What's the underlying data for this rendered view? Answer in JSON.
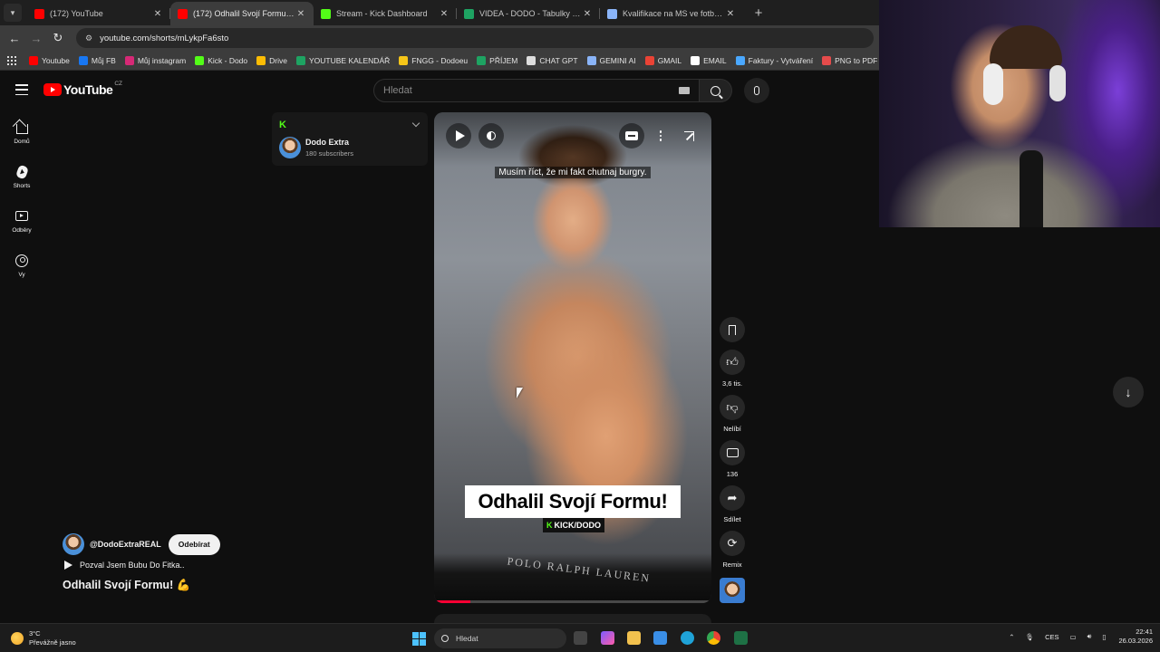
{
  "browser": {
    "tabs": [
      {
        "title": "(172) YouTube",
        "favicon_color": "#ff0000",
        "active": false
      },
      {
        "title": "(172) Odhalil Svojí Formu! 💪 🔊",
        "favicon_color": "#ff0000",
        "active": true
      },
      {
        "title": "Stream - Kick Dashboard",
        "favicon_color": "#53fc18",
        "active": false
      },
      {
        "title": "VIDEA - DODO - Tabulky Googl",
        "favicon_color": "#1ea362",
        "active": false
      },
      {
        "title": "Kvalifikace na MS ve fotbale 20...",
        "favicon_color": "#8ab4f8",
        "active": false
      }
    ],
    "url": "youtube.com/shorts/mLykpFa6sto",
    "bookmarks": [
      {
        "label": "Youtube",
        "color": "#ff0000"
      },
      {
        "label": "Můj FB",
        "color": "#1877f2"
      },
      {
        "label": "Můj instagram",
        "color": "#d62976"
      },
      {
        "label": "Kick - Dodo",
        "color": "#53fc18"
      },
      {
        "label": "Drive",
        "color": "#fbbc04"
      },
      {
        "label": "YOUTUBE KALENDÁŘ",
        "color": "#1ea362"
      },
      {
        "label": "FNGG - Dodoeu",
        "color": "#f5c518"
      },
      {
        "label": "PŘÍJEM",
        "color": "#1ea362"
      },
      {
        "label": "CHAT GPT",
        "color": "#dddddd"
      },
      {
        "label": "GEMINI AI",
        "color": "#8ab4f8"
      },
      {
        "label": "GMAIL",
        "color": "#ea4335"
      },
      {
        "label": "EMAIL",
        "color": "#ffffff"
      },
      {
        "label": "Faktury - Vytváření",
        "color": "#4aa8ff"
      },
      {
        "label": "PNG to PDF",
        "color": "#e54b4b"
      }
    ]
  },
  "youtube": {
    "logo_text": "YouTube",
    "country": "CZ",
    "search_placeholder": "Hledat",
    "nav": [
      {
        "label": "Domů"
      },
      {
        "label": "Shorts"
      },
      {
        "label": "Odběry"
      },
      {
        "label": "Vy"
      }
    ],
    "channel_card": {
      "name": "Dodo Extra",
      "subscribers": "180 subscribers"
    },
    "video": {
      "caption": "Musím říct, že mi fakt chutnaj burgry.",
      "overlay_title": "Odhalil Svojí Formu!",
      "kick_tag": "KICK/DODO",
      "waistband_text": "POLO RALPH LAUREN",
      "progress_fraction": 0.13
    },
    "actions": {
      "likes": "3,6 tis.",
      "dislike_label": "Nelíbí",
      "comments": "136",
      "share_label": "Sdílet",
      "remix_label": "Remix"
    },
    "owner": {
      "handle": "@DodoExtraREAL",
      "subscribe_label": "Odebírat",
      "playlist": "Pozval Jsem Bubu Do Fitka..",
      "title": "Odhalil Svojí Formu! 💪"
    }
  },
  "taskbar": {
    "temperature": "3°C",
    "weather": "Převážně jasno",
    "search_placeholder": "Hledat",
    "language": "CES",
    "time": "22:41",
    "date": "26.03.2026"
  }
}
